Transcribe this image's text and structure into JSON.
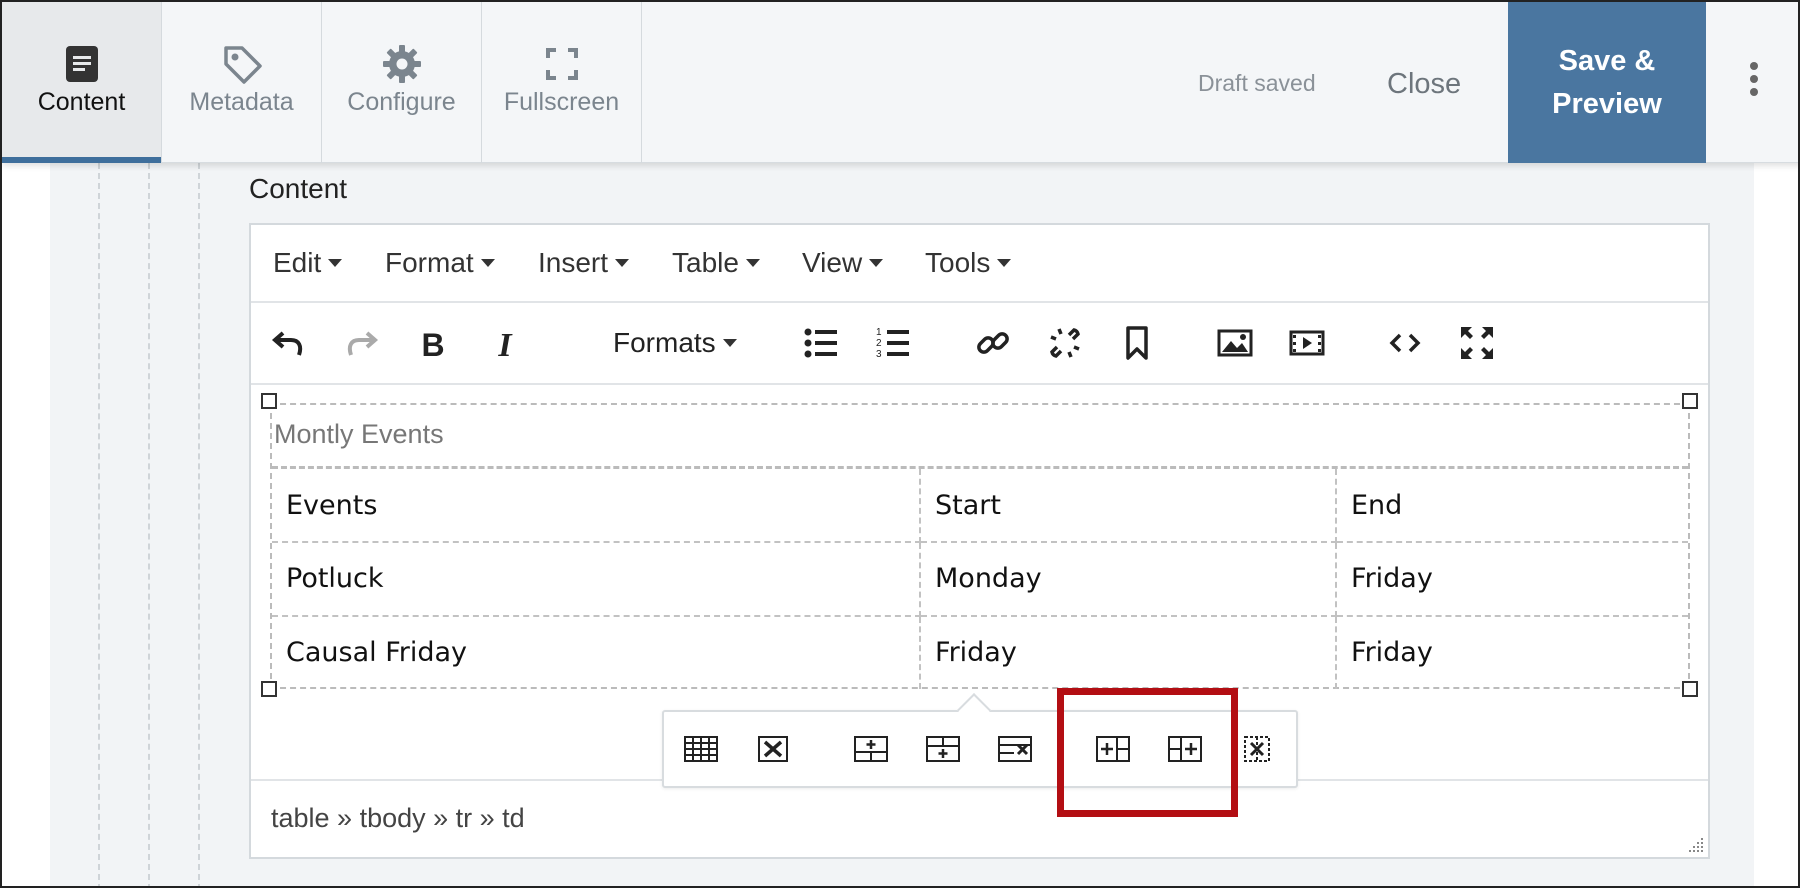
{
  "tabs": [
    {
      "label": "Content",
      "icon": "document-icon",
      "active": true
    },
    {
      "label": "Metadata",
      "icon": "tag-icon",
      "active": false
    },
    {
      "label": "Configure",
      "icon": "gear-icon",
      "active": false
    },
    {
      "label": "Fullscreen",
      "icon": "fullscreen-icon",
      "active": false
    }
  ],
  "header": {
    "status": "Draft saved",
    "close_label": "Close",
    "save_label_line1": "Save &",
    "save_label_line2": "Preview",
    "more_icon": "kebab-menu-icon"
  },
  "field": {
    "label": "Content"
  },
  "editor": {
    "menus": [
      "Edit",
      "Format",
      "Insert",
      "Table",
      "View",
      "Tools"
    ],
    "toolbar": {
      "icons": [
        "undo-icon",
        "redo-icon",
        "bold-icon",
        "italic-icon",
        "bullet-list-icon",
        "numbered-list-icon",
        "link-icon",
        "unlink-icon",
        "bookmark-icon",
        "image-icon",
        "media-icon",
        "code-icon",
        "fullscreen-icon"
      ],
      "formats_label": "Formats"
    },
    "status_path": "table » tbody » tr » td"
  },
  "table": {
    "caption": "Montly Events",
    "rows": [
      [
        "Events",
        "Start",
        "End"
      ],
      [
        "Potluck",
        "Monday",
        "Friday"
      ],
      [
        "Causal Friday",
        "Friday",
        "Friday"
      ]
    ]
  },
  "table_popup": {
    "icons": [
      "table-properties-icon",
      "delete-table-icon",
      "insert-row-before-icon",
      "insert-row-after-icon",
      "delete-row-icon",
      "insert-column-before-icon",
      "insert-column-after-icon",
      "delete-column-icon"
    ],
    "highlighted": [
      "insert-column-before-icon",
      "insert-column-after-icon"
    ]
  },
  "colors": {
    "accent": "#4a76a0",
    "highlight": "#b30e13",
    "topbar": "#f4f6f8"
  }
}
